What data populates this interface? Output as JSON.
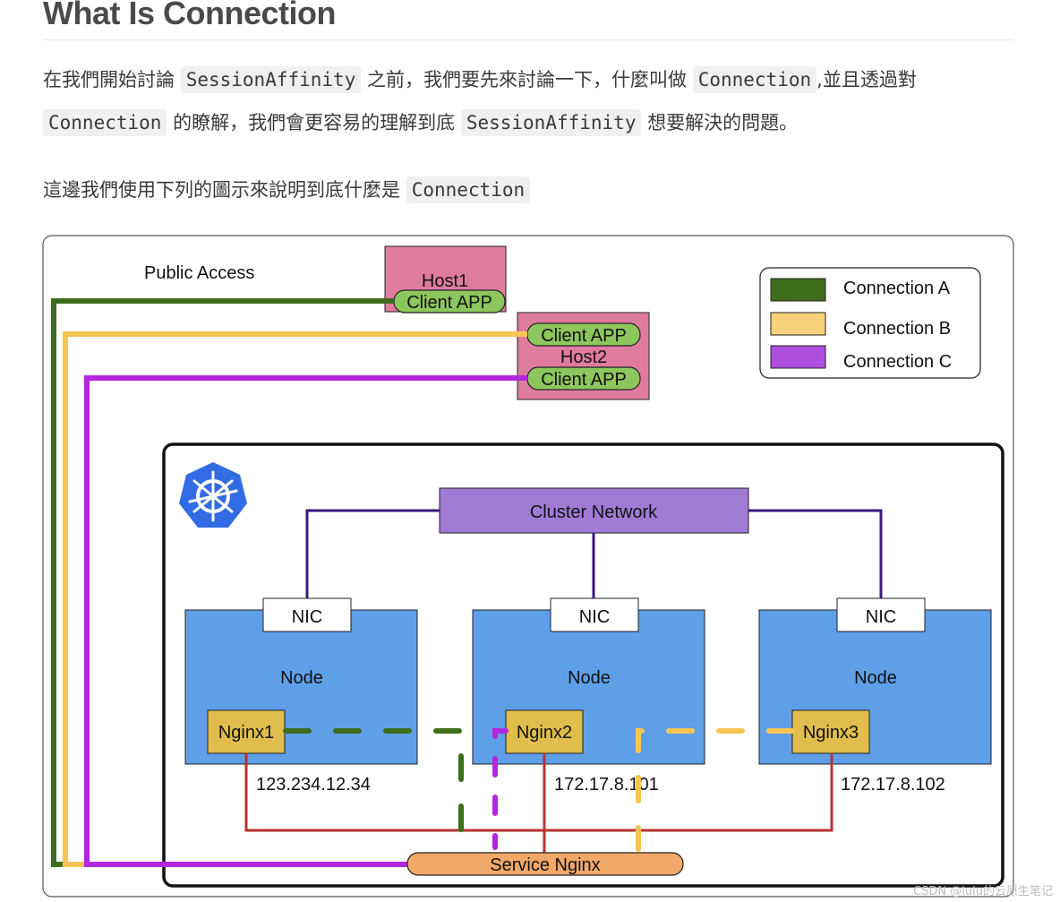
{
  "heading": "What Is Connection",
  "paragraph1": {
    "t1": "在我們開始討論",
    "code1": "SessionAffinity",
    "t2": "之前，我們要先來討論一下，什麼叫做",
    "code2": "Connection",
    "t3": ",並且透過對"
  },
  "paragraph2": {
    "code1": "Connection",
    "t1": "的瞭解，我們會更容易的理解到底",
    "code2": "SessionAffinity",
    "t2": "想要解決的問題。"
  },
  "paragraph3": {
    "t1": "這邊我們使用下列的圖示來說明到底什麼是",
    "code1": "Connection"
  },
  "diagram": {
    "public_access_label": "Public Access",
    "host1": {
      "label": "Host1",
      "client": "Client APP"
    },
    "host2": {
      "label": "Host2",
      "client_top": "Client APP",
      "client_bottom": "Client APP"
    },
    "legend": [
      {
        "label": "Connection A",
        "color": "#3e6e1c"
      },
      {
        "label": "Connection B",
        "color": "#f7d27a"
      },
      {
        "label": "Connection C",
        "color": "#ae4fe0"
      }
    ],
    "colors": {
      "conn_a": "#3e6e1c",
      "conn_b": "#f7c555",
      "conn_c": "#b226de",
      "network_line": "#3a1a80",
      "red_line": "#b83232",
      "node": "#5f9fe8",
      "nginx": "#e0bd4c",
      "host": "#e07ba0",
      "client": "#8cc65c",
      "cluster_network": "#a07ad4",
      "service": "#f2a868",
      "k8s_logo": "#326ce5"
    },
    "cluster_network_label": "Cluster Network",
    "nic_label": "NIC",
    "nodes": [
      {
        "label": "Node",
        "nginx": "Nginx1",
        "ip": "123.234.12.34"
      },
      {
        "label": "Node",
        "nginx": "Nginx2",
        "ip": "172.17.8.101"
      },
      {
        "label": "Node",
        "nginx": "Nginx3",
        "ip": "172.17.8.102"
      }
    ],
    "service_label": "Service Nginx",
    "k8s_icon": "kubernetes-helm-icon"
  },
  "watermark": "CSDN @lulu的云原生笔记"
}
